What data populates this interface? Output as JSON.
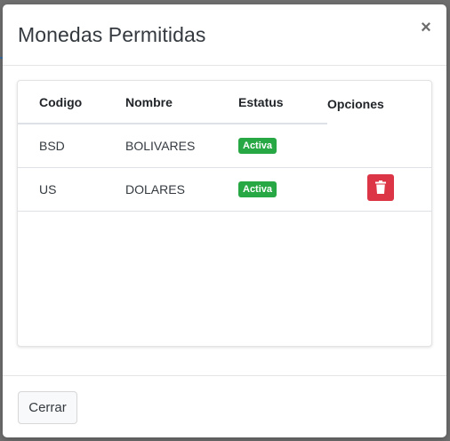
{
  "modal": {
    "title": "Monedas Permitidas",
    "close_symbol": "×"
  },
  "table": {
    "headers": {
      "codigo": "Codigo",
      "nombre": "Nombre",
      "estatus": "Estatus",
      "opciones": "Opciones"
    },
    "rows": [
      {
        "codigo": "BSD",
        "nombre": "BOLIVARES",
        "estatus": "Activa",
        "has_delete": false
      },
      {
        "codigo": "US",
        "nombre": "DOLARES",
        "estatus": "Activa",
        "has_delete": true
      }
    ]
  },
  "footer": {
    "close_label": "Cerrar"
  },
  "icons": {
    "close": "close-icon",
    "delete": "trash-icon"
  },
  "colors": {
    "badge_active": "#28a745",
    "delete_button": "#dc3545"
  }
}
